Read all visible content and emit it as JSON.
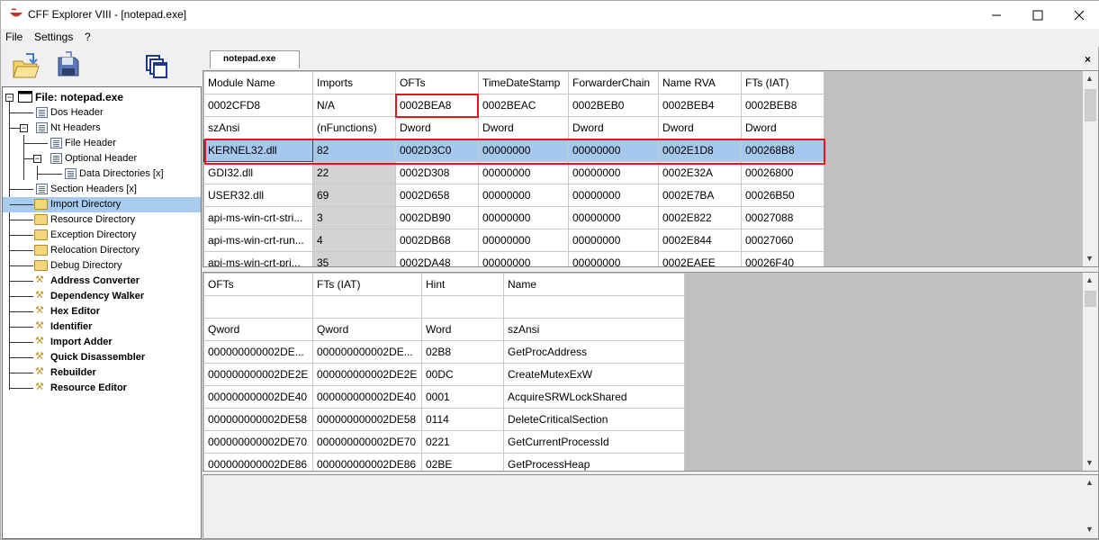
{
  "window": {
    "title": "CFF Explorer VIII - [notepad.exe]",
    "minimize_label": "—",
    "maximize_label": "☐",
    "close_label": "✕"
  },
  "menu": [
    "File",
    "Settings",
    "?"
  ],
  "tab": {
    "label": "notepad.exe",
    "close_label": "×"
  },
  "tree": {
    "root": "File: notepad.exe",
    "items": [
      {
        "label": "Dos Header"
      },
      {
        "label": "Nt Headers"
      },
      {
        "label": "File Header"
      },
      {
        "label": "Optional Header"
      },
      {
        "label": "Data Directories [x]"
      },
      {
        "label": "Section Headers [x]"
      },
      {
        "label": "Import Directory"
      },
      {
        "label": "Resource Directory"
      },
      {
        "label": "Exception Directory"
      },
      {
        "label": "Relocation Directory"
      },
      {
        "label": "Debug Directory"
      },
      {
        "label": "Address Converter"
      },
      {
        "label": "Dependency Walker"
      },
      {
        "label": "Hex Editor"
      },
      {
        "label": "Identifier"
      },
      {
        "label": "Import Adder"
      },
      {
        "label": "Quick Disassembler"
      },
      {
        "label": "Rebuilder"
      },
      {
        "label": "Resource Editor"
      }
    ]
  },
  "imports_table": {
    "headers": [
      "Module Name",
      "Imports",
      "OFTs",
      "TimeDateStamp",
      "ForwarderChain",
      "Name RVA",
      "FTs (IAT)"
    ],
    "offsets": [
      "0002CFD8",
      "N/A",
      "0002BEA8",
      "0002BEAC",
      "0002BEB0",
      "0002BEB4",
      "0002BEB8"
    ],
    "types": [
      "szAnsi",
      "(nFunctions)",
      "Dword",
      "Dword",
      "Dword",
      "Dword",
      "Dword"
    ],
    "rows": [
      [
        "KERNEL32.dll",
        "82",
        "0002D3C0",
        "00000000",
        "00000000",
        "0002E1D8",
        "000268B8"
      ],
      [
        "GDI32.dll",
        "22",
        "0002D308",
        "00000000",
        "00000000",
        "0002E32A",
        "00026800"
      ],
      [
        "USER32.dll",
        "69",
        "0002D658",
        "00000000",
        "00000000",
        "0002E7BA",
        "00026B50"
      ],
      [
        "api-ms-win-crt-stri...",
        "3",
        "0002DB90",
        "00000000",
        "00000000",
        "0002E822",
        "00027088"
      ],
      [
        "api-ms-win-crt-run...",
        "4",
        "0002DB68",
        "00000000",
        "00000000",
        "0002E844",
        "00027060"
      ],
      [
        "api-ms-win-crt-pri...",
        "35",
        "0002DA48",
        "00000000",
        "00000000",
        "0002EAEE",
        "00026F40"
      ]
    ]
  },
  "functions_table": {
    "headers": [
      "OFTs",
      "FTs (IAT)",
      "Hint",
      "Name"
    ],
    "types": [
      "Qword",
      "Qword",
      "Word",
      "szAnsi"
    ],
    "rows": [
      [
        "000000000002DE...",
        "000000000002DE...",
        "02B8",
        "GetProcAddress"
      ],
      [
        "000000000002DE2E",
        "000000000002DE2E",
        "00DC",
        "CreateMutexExW"
      ],
      [
        "000000000002DE40",
        "000000000002DE40",
        "0001",
        "AcquireSRWLockShared"
      ],
      [
        "000000000002DE58",
        "000000000002DE58",
        "0114",
        "DeleteCriticalSection"
      ],
      [
        "000000000002DE70",
        "000000000002DE70",
        "0221",
        "GetCurrentProcessId"
      ],
      [
        "000000000002DE86",
        "000000000002DE86",
        "02BE",
        "GetProcessHeap"
      ]
    ]
  },
  "colors": {
    "highlight": "#e8141c",
    "selection": "#a6c8ef",
    "tree_selection": "#a6cdf0"
  }
}
